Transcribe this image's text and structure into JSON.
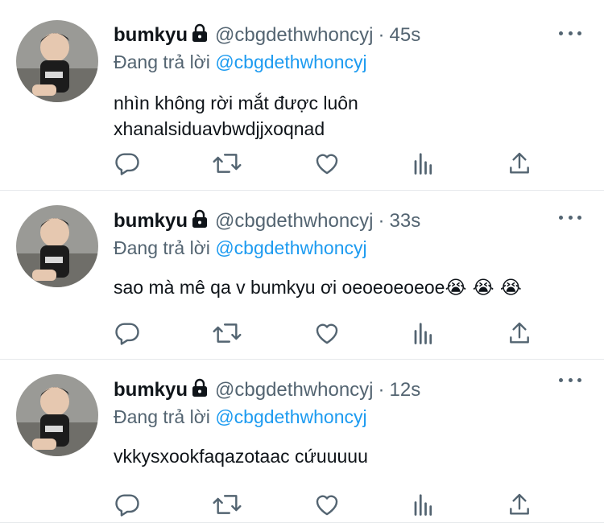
{
  "tweets": [
    {
      "name": "bumkyu",
      "handle": "@cbgdethwhoncyj",
      "separator": "·",
      "time": "45s",
      "reply_prefix": "Đang trả lời",
      "reply_to": "@cbgdethwhoncyj",
      "text_lines": [
        "nhìn không rời mắt được luôn",
        "xhanalsiduavbwdjjxoqnad"
      ],
      "emoji": ""
    },
    {
      "name": "bumkyu",
      "handle": "@cbgdethwhoncyj",
      "separator": "·",
      "time": "33s",
      "reply_prefix": "Đang trả lời",
      "reply_to": "@cbgdethwhoncyj",
      "text_lines": [
        "sao mà mê qa v bumkyu ơi oeoeoeoeoe"
      ],
      "emoji": "😭 😭 😭"
    },
    {
      "name": "bumkyu",
      "handle": "@cbgdethwhoncyj",
      "separator": "·",
      "time": "12s",
      "reply_prefix": "Đang trả lời",
      "reply_to": "@cbgdethwhoncyj",
      "text_lines": [
        "vkkysxookfaqazotaac cứuuuuu"
      ],
      "emoji": ""
    }
  ],
  "icons": {
    "reply": "reply-icon",
    "retweet": "retweet-icon",
    "like": "heart-icon",
    "views": "analytics-icon",
    "share": "share-icon",
    "more": "more-icon",
    "protected": "lock-icon"
  },
  "colors": {
    "text_primary": "#0f1419",
    "text_secondary": "#536471",
    "link": "#1d9bf0",
    "divider": "#e6e9ec"
  }
}
